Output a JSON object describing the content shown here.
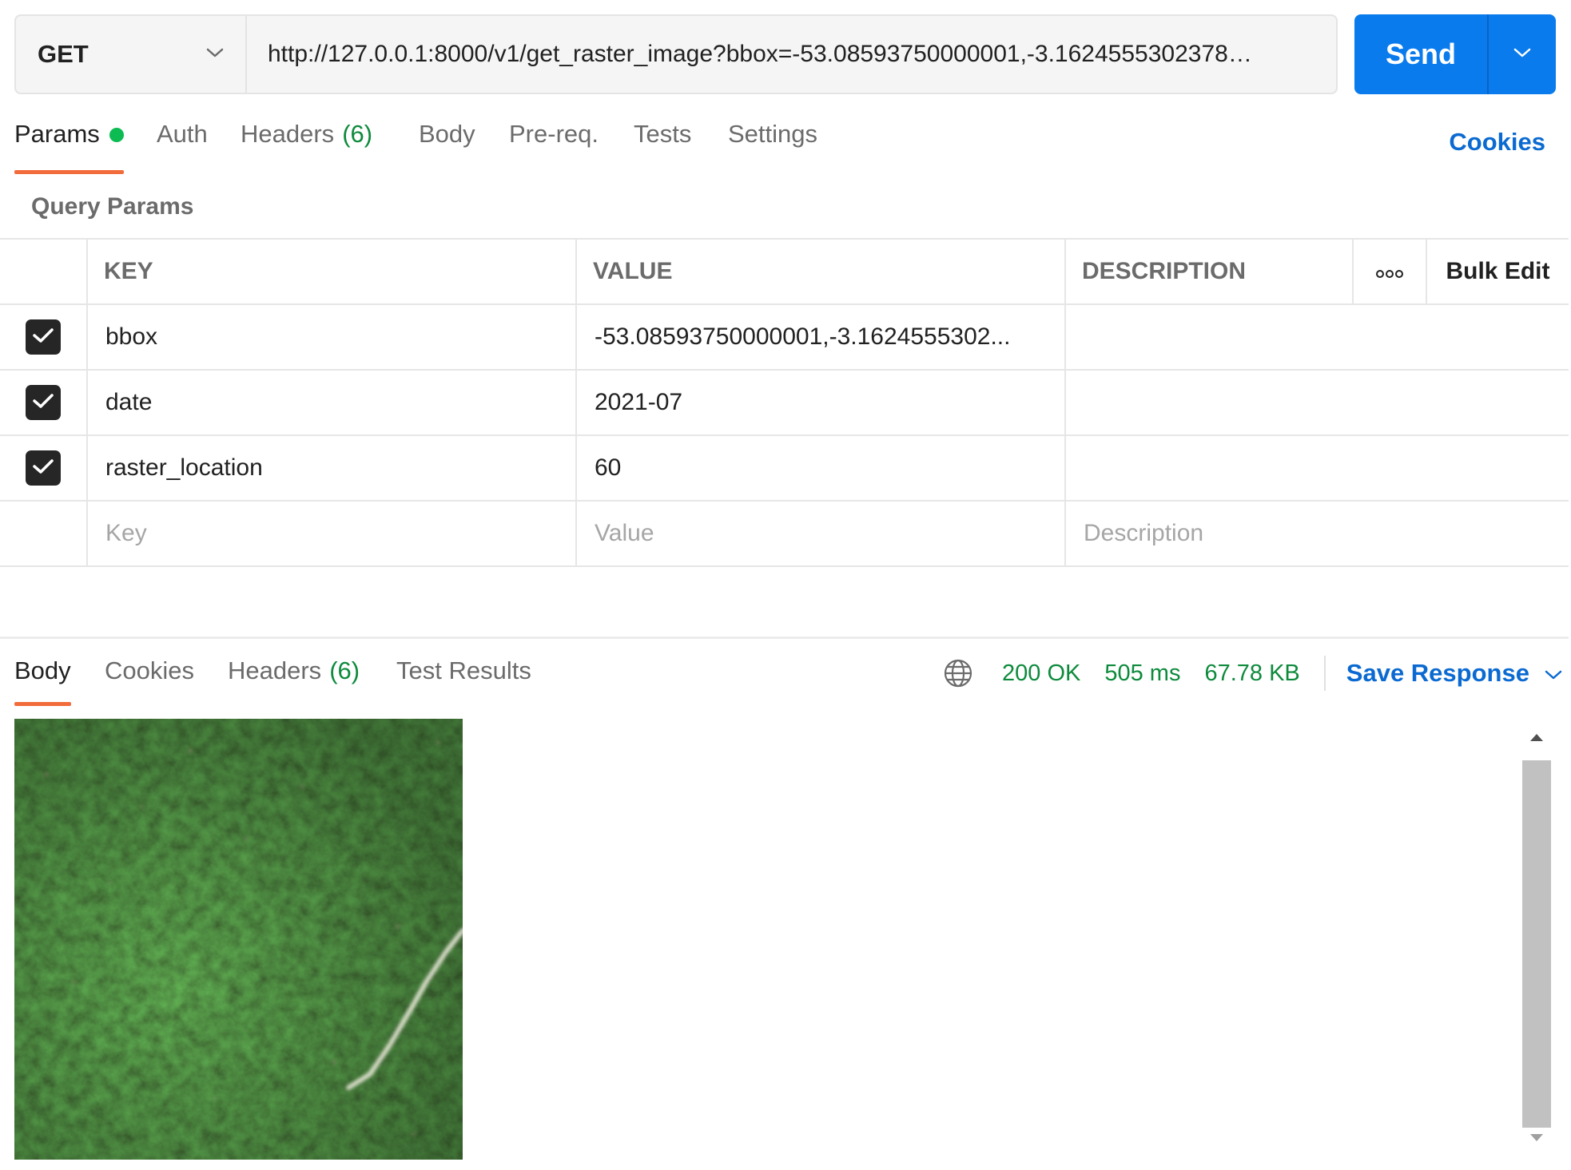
{
  "request": {
    "method": "GET",
    "url": "http://127.0.0.1:8000/v1/get_raster_image?bbox=-53.08593750000001,-3.1624555302378…",
    "send_label": "Send"
  },
  "request_tabs": {
    "params": "Params",
    "auth": "Auth",
    "headers": "Headers",
    "headers_count": "(6)",
    "body": "Body",
    "prereq": "Pre-req.",
    "tests": "Tests",
    "settings": "Settings",
    "cookies": "Cookies"
  },
  "query_params": {
    "title": "Query Params",
    "headers": {
      "key": "KEY",
      "value": "VALUE",
      "description": "DESCRIPTION",
      "bulk_edit": "Bulk Edit"
    },
    "rows": [
      {
        "key": "bbox",
        "value": "-53.08593750000001,-3.1624555302...",
        "checked": true
      },
      {
        "key": "date",
        "value": "2021-07",
        "checked": true
      },
      {
        "key": "raster_location",
        "value": "60",
        "checked": true
      }
    ],
    "placeholders": {
      "key": "Key",
      "value": "Value",
      "description": "Description"
    }
  },
  "response_tabs": {
    "body": "Body",
    "cookies": "Cookies",
    "headers": "Headers",
    "headers_count": "(6)",
    "test_results": "Test Results"
  },
  "response_status": {
    "status": "200 OK",
    "time": "505 ms",
    "size": "67.78 KB",
    "save_response": "Save Response"
  },
  "icons": {
    "method_dropdown": "chevron-down-icon",
    "send_dropdown": "chevron-down-icon",
    "checkbox": "check-icon",
    "more": "more-horizontal-icon",
    "globe": "globe-icon",
    "save_dropdown": "chevron-down-icon",
    "scroll_up": "triangle-up-icon",
    "scroll_down": "triangle-down-icon"
  },
  "colors": {
    "send_button": "#097bed",
    "active_tab_underline": "#f26b3a",
    "status_green": "#0d8a3c",
    "link_blue": "#0b6ad1",
    "params_dot": "#0cbb52"
  }
}
